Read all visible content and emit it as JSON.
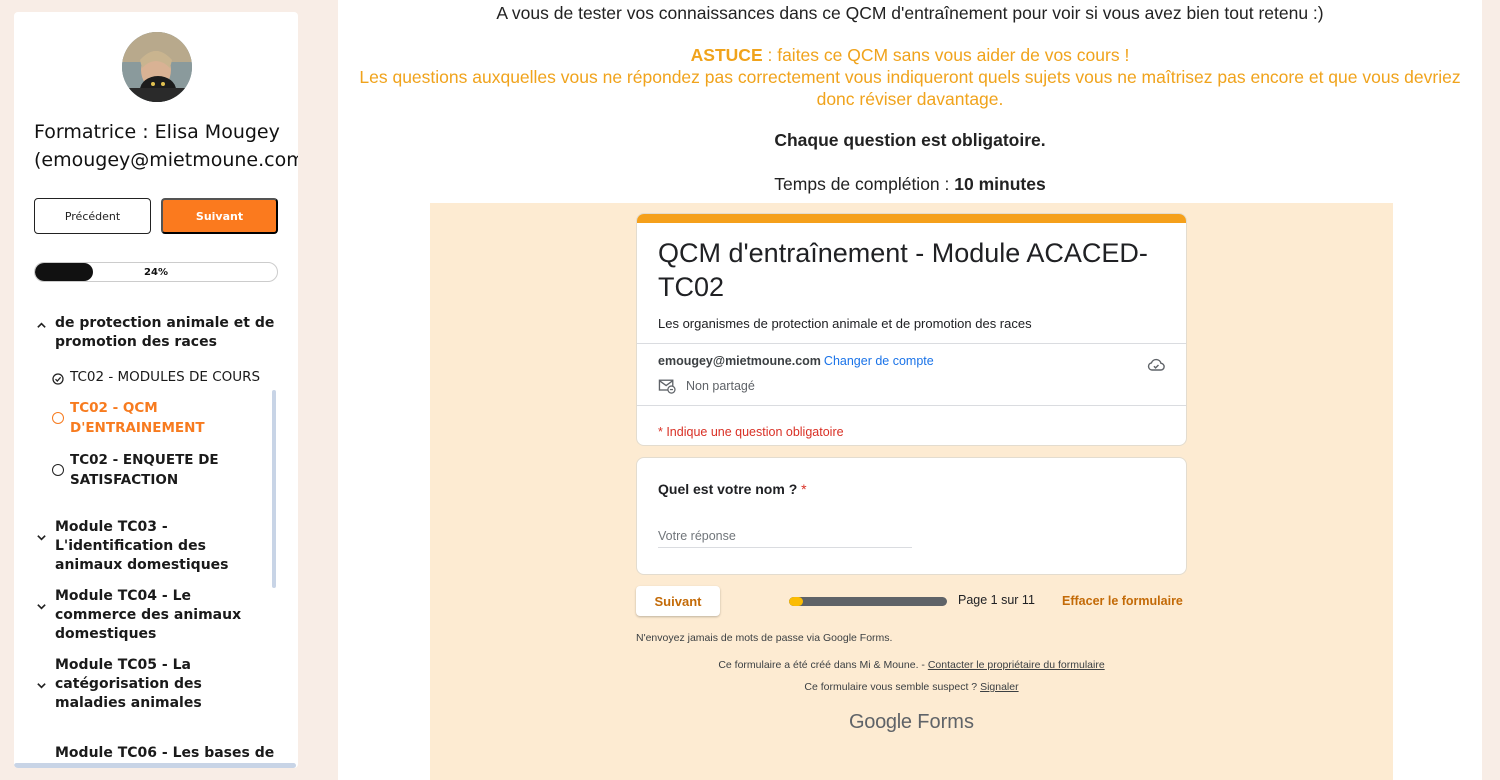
{
  "sidebar": {
    "trainer_label": "Formatrice : Elisa Mougey (emougey@mietmoune.com)",
    "prev_label": "Précédent",
    "next_label": "Suivant",
    "progress_text": "24%",
    "progress_value": 0.24,
    "sections": [
      {
        "label": "de protection animale et de promotion des races",
        "icon": "chevron-up-icon",
        "expanded": true,
        "lessons": [
          {
            "label": "TC02 - MODULES DE COURS",
            "status": "completed",
            "icon": "check-circle-icon"
          },
          {
            "label": "TC02 - QCM D'ENTRAINEMENT",
            "status": "current",
            "icon": "circle-icon"
          },
          {
            "label": "TC02 - ENQUETE DE SATISFACTION",
            "status": "not-started",
            "icon": "circle-icon"
          }
        ]
      },
      {
        "label": "Module TC03 - L'identification des animaux domestiques",
        "icon": "chevron-down-icon"
      },
      {
        "label": "Module TC04 - Le commerce des animaux domestiques",
        "icon": "chevron-down-icon"
      },
      {
        "label": "Module TC05 - La catégorisation des maladies animales",
        "icon": "chevron-down-icon"
      },
      {
        "label": "Module TC06 - Les bases de",
        "icon": "chevron-down-icon"
      }
    ]
  },
  "main": {
    "intro": "A vous de tester vos connaissances dans ce QCM d'entraînement pour voir si vous avez bien tout retenu :)",
    "tip_label": "ASTUCE",
    "tip_line1": " : faites ce QCM sans vous aider de vos cours !",
    "tip_line2": "Les questions auxquelles vous ne répondez pas correctement vous indiqueront quels sujets vous ne maîtrisez pas encore et que vous devriez donc réviser davantage.",
    "mandatory": "Chaque question est obligatoire.",
    "duration_label": "Temps de complétion : ",
    "duration_value": "10 minutes"
  },
  "form": {
    "title": "QCM d'entraînement -  Module ACACED-TC02",
    "description": "Les organismes de protection animale et de promotion des races",
    "account_email": "emougey@mietmoune.com",
    "switch_account": "Changer de compte",
    "not_shared": "Non partagé",
    "required_note": "* Indique une question obligatoire",
    "question_label": "Quel est votre nom ?",
    "required_star": "*",
    "answer_placeholder": "Votre réponse",
    "next_button": "Suivant",
    "progress_value": 0.091,
    "page_indicator": "Page 1 sur 11",
    "clear_form": "Effacer le formulaire",
    "never_passwords": "N'envoyez jamais de mots de passe via Google Forms.",
    "created_text": "Ce formulaire a été créé dans Mi & Moune. - ",
    "contact_owner": "Contacter le propriétaire du formulaire",
    "suspect_text": "Ce formulaire vous semble suspect ? ",
    "report": "Signaler",
    "brand_google": "Google",
    "brand_forms": "Forms"
  },
  "colors": {
    "accent_orange": "#fb7a1e",
    "tip_yellow": "#f0a31c",
    "form_bar": "#f5a01b",
    "form_bg": "#fdebd2",
    "link_blue": "#1a73e8",
    "required_red": "#d93025"
  }
}
